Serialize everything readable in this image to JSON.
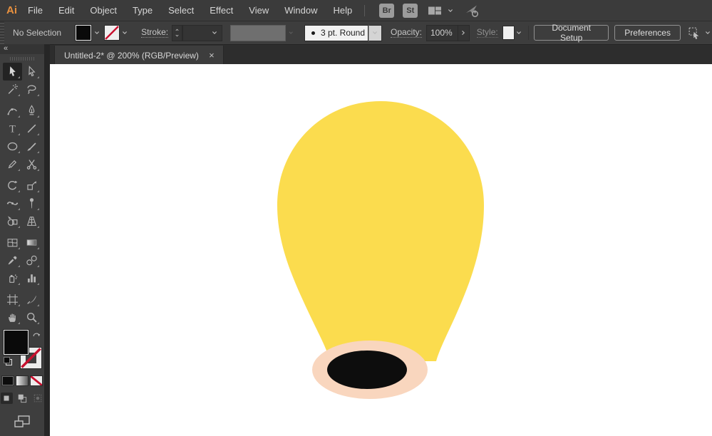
{
  "app": {
    "logo_text": "Ai"
  },
  "menu_bar": {
    "items": [
      "File",
      "Edit",
      "Object",
      "Type",
      "Select",
      "Effect",
      "View",
      "Window",
      "Help"
    ],
    "bridge_badge": "Br",
    "stock_badge": "St"
  },
  "control_bar": {
    "selection_status": "No Selection",
    "stroke_label": "Stroke:",
    "brush_definition": "3 pt. Round",
    "opacity_label": "Opacity:",
    "opacity_value": "100%",
    "style_label": "Style:",
    "document_setup_button": "Document Setup",
    "preferences_button": "Preferences"
  },
  "document_tab": {
    "title": "Untitled-2* @ 200% (RGB/Preview)",
    "close_glyph": "×"
  },
  "toolbar": {
    "collapse_glyph": "«",
    "tool_groups": [
      [
        {
          "name": "selection-tool",
          "selected": true
        },
        {
          "name": "direct-selection-tool"
        },
        {
          "name": "magic-wand-tool"
        },
        {
          "name": "lasso-tool"
        }
      ],
      [
        {
          "name": "curvature-tool"
        },
        {
          "name": "pen-tool"
        },
        {
          "name": "type-tool"
        },
        {
          "name": "line-segment-tool"
        },
        {
          "name": "ellipse-tool"
        },
        {
          "name": "paintbrush-tool"
        },
        {
          "name": "pencil-tool"
        },
        {
          "name": "scissors-tool"
        }
      ],
      [
        {
          "name": "rotate-tool"
        },
        {
          "name": "scale-tool"
        },
        {
          "name": "width-tool"
        },
        {
          "name": "puppet-warp-tool"
        },
        {
          "name": "shape-builder-tool"
        },
        {
          "name": "perspective-grid-tool"
        }
      ],
      [
        {
          "name": "mesh-tool"
        },
        {
          "name": "gradient-tool"
        },
        {
          "name": "eyedropper-tool"
        },
        {
          "name": "blend-tool"
        },
        {
          "name": "symbol-sprayer-tool"
        },
        {
          "name": "column-graph-tool"
        }
      ],
      [
        {
          "name": "artboard-tool"
        },
        {
          "name": "slice-tool"
        },
        {
          "name": "hand-tool"
        },
        {
          "name": "zoom-tool"
        }
      ]
    ]
  },
  "canvas": {
    "artwork": {
      "balloon_fill": "#FBDC4E",
      "base_fill": "#F9D6BE",
      "hole_fill": "#0D0D0D"
    }
  },
  "colors": {
    "logo_orange": "#E8913F",
    "none_slash_red": "#C8102E",
    "ui_dark_gray": "#3D3D3D",
    "app_background": "#262626"
  }
}
